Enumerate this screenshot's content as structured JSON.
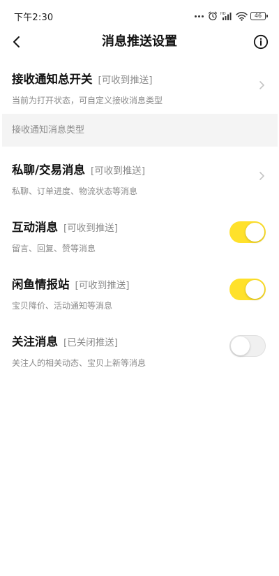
{
  "status_bar": {
    "time": "下午2:30",
    "battery": "46",
    "icons": [
      "more-dots-icon",
      "alarm-icon",
      "signal-hd-icon",
      "wifi-icon",
      "battery-icon"
    ]
  },
  "nav": {
    "title": "消息推送设置",
    "back_icon": "chevron-left-icon",
    "info_icon": "info-circle-icon"
  },
  "master_switch": {
    "title": "接收通知总开关",
    "status": "[可收到推送]",
    "description": "当前为打开状态，可自定义接收消息类型"
  },
  "section_header": "接收通知消息类型",
  "items": [
    {
      "title": "私聊/交易消息",
      "status": "[可收到推送]",
      "description": "私聊、订单进度、物流状态等消息",
      "control": "chevron"
    },
    {
      "title": "互动消息",
      "status": "[可收到推送]",
      "description": "留言、回复、赞等消息",
      "control": "toggle",
      "enabled": true
    },
    {
      "title": "闲鱼情报站",
      "status": "[可收到推送]",
      "description": "宝贝降价、活动通知等消息",
      "control": "toggle",
      "enabled": true
    },
    {
      "title": "关注消息",
      "status": "[已关闭推送]",
      "description": "关注人的相关动态、宝贝上新等消息",
      "control": "toggle",
      "enabled": false
    }
  ],
  "colors": {
    "toggle_on": "#ffe12b",
    "toggle_off": "#f0f0f0",
    "secondary_text": "#8a8a8a",
    "section_bg": "#f4f4f4"
  }
}
